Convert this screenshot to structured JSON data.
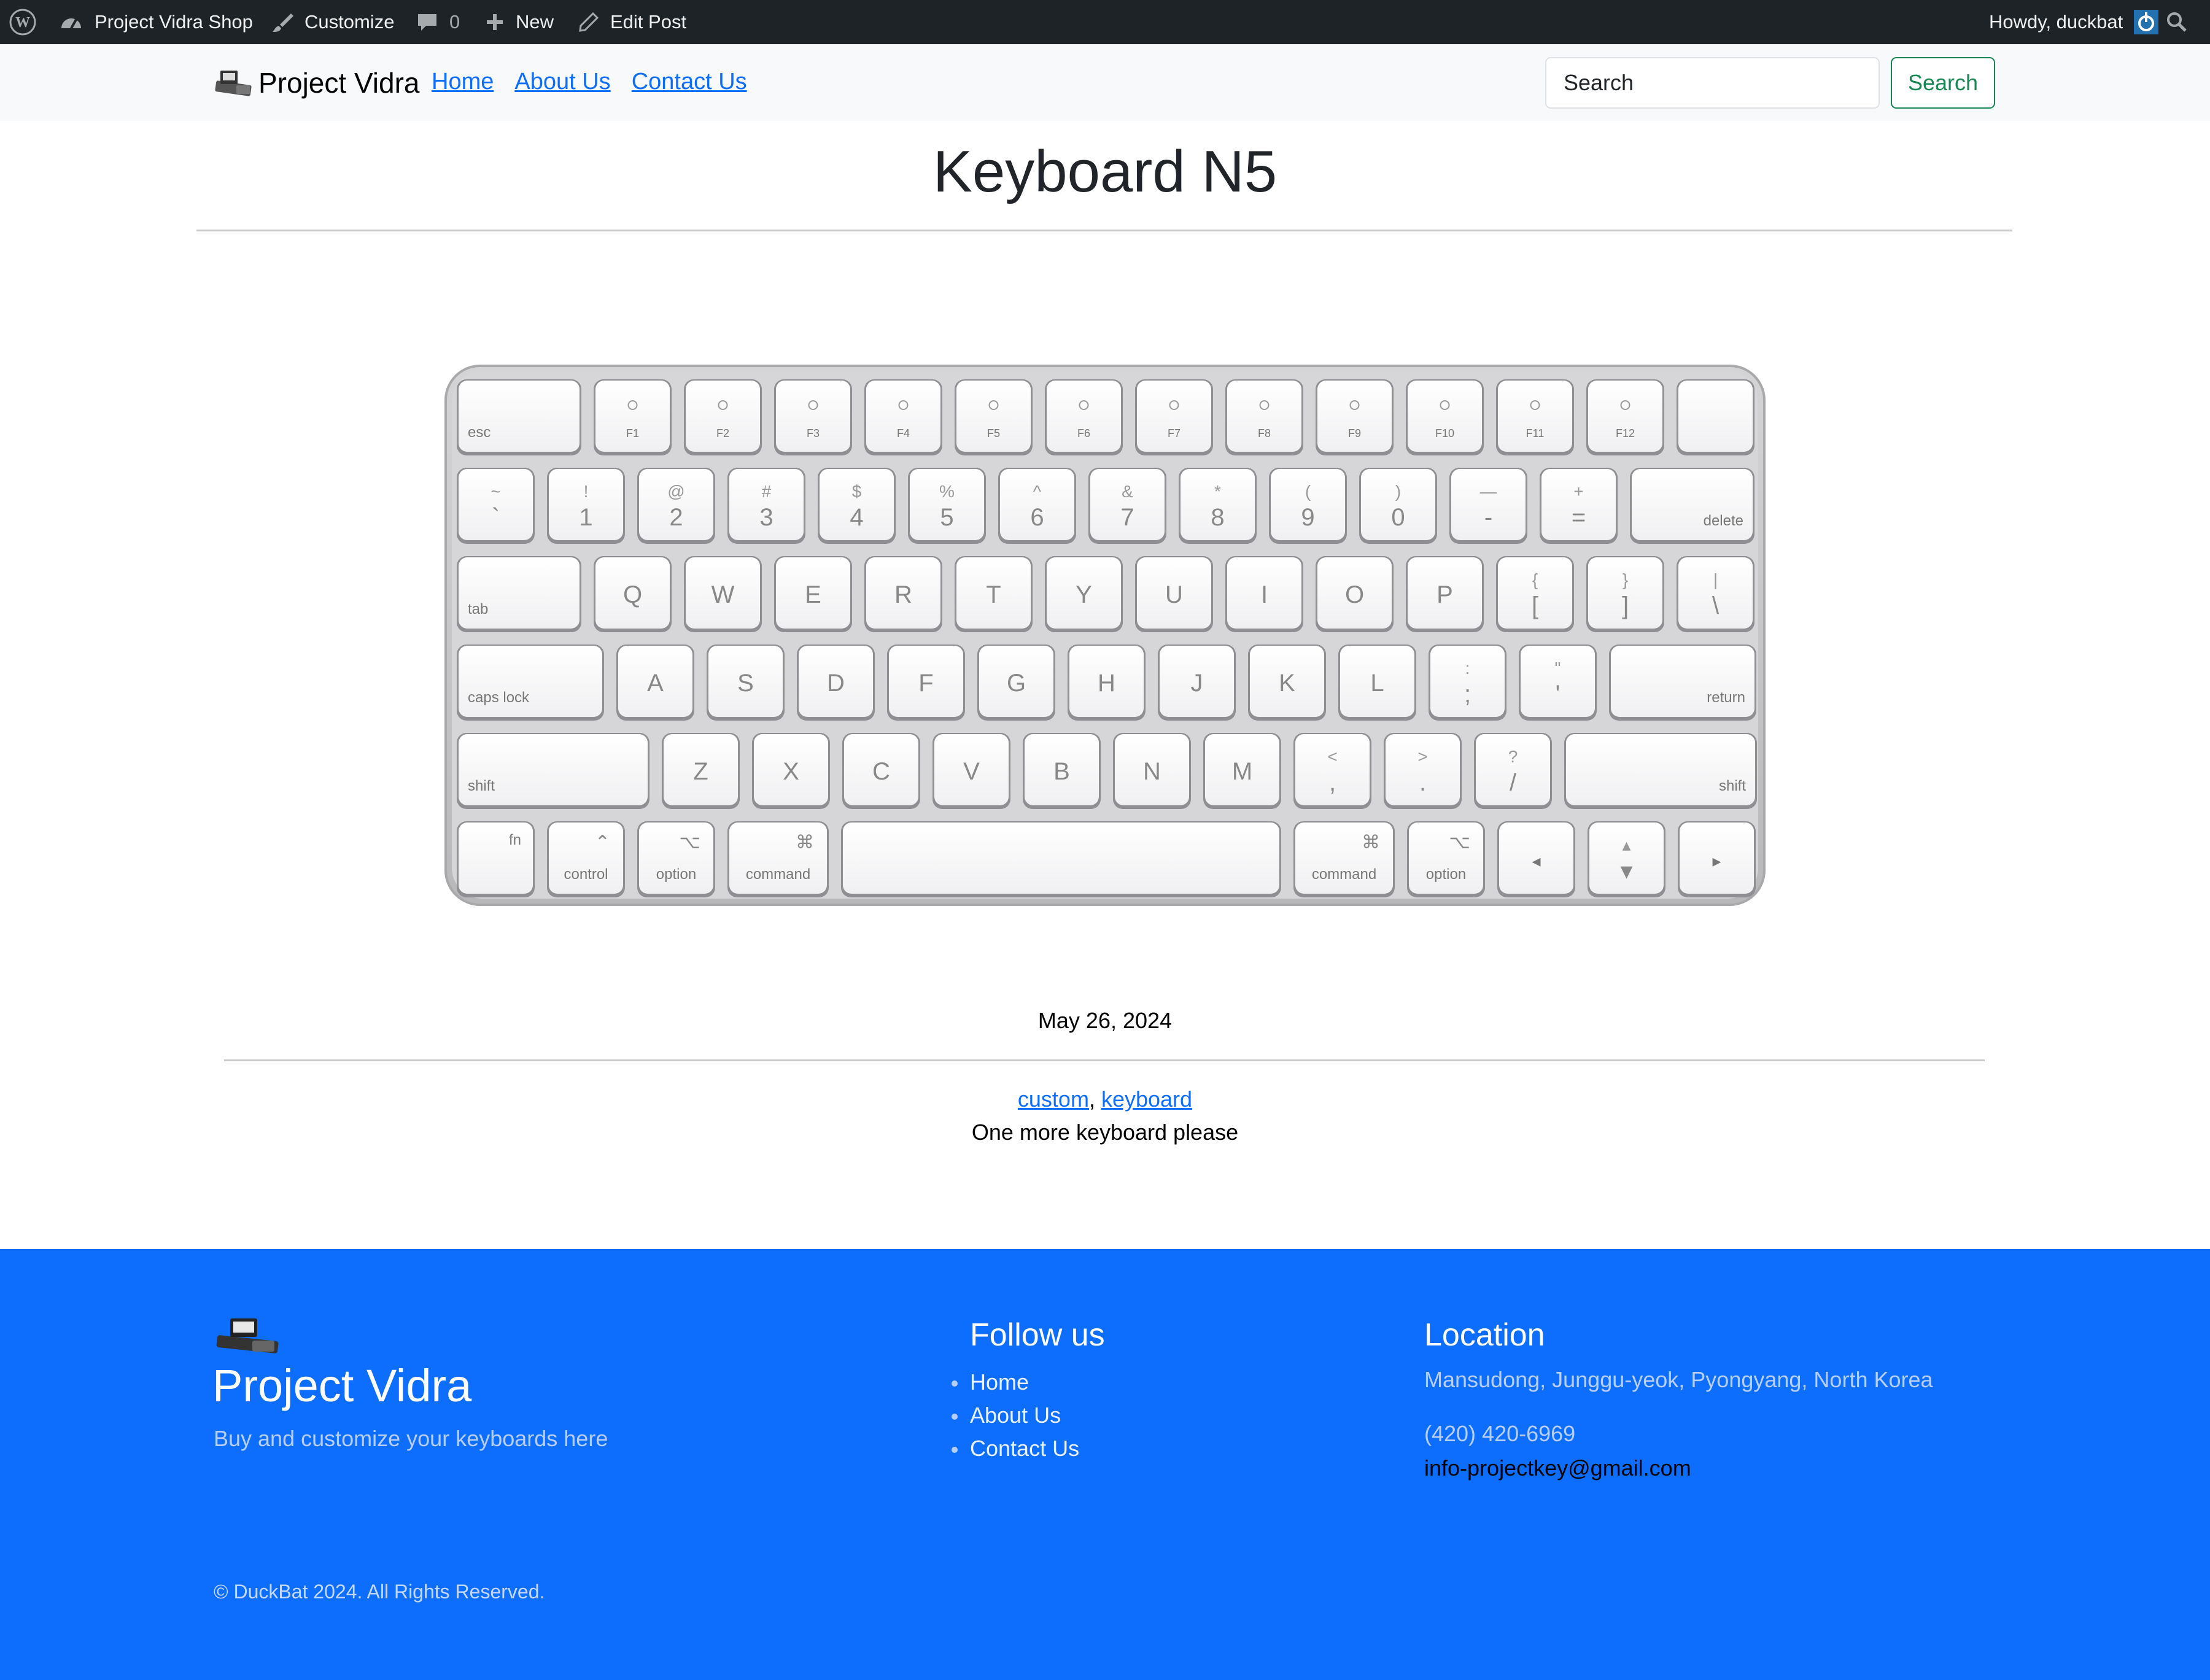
{
  "admin_bar": {
    "site_name": "Project Vidra Shop",
    "customize": "Customize",
    "comments_count": "0",
    "new_label": "New",
    "edit_post": "Edit Post",
    "howdy": "Howdy, duckbat"
  },
  "navbar": {
    "brand": "Project Vidra",
    "links": [
      "Home",
      "About Us",
      "Contact Us"
    ],
    "search_placeholder": "Search",
    "search_button": "Search"
  },
  "post": {
    "title": "Keyboard N5",
    "date": "May 26, 2024",
    "tags": [
      "custom",
      "keyboard"
    ],
    "tag_separator": ", ",
    "excerpt": "One more keyboard please"
  },
  "keyboard_image": {
    "rows": [
      [
        [
          "esc",
          ""
        ],
        [
          "",
          "F1"
        ],
        [
          "",
          "F2"
        ],
        [
          "",
          "F3"
        ],
        [
          "",
          "F4"
        ],
        [
          "",
          "F5"
        ],
        [
          "",
          "F6"
        ],
        [
          "",
          "F7"
        ],
        [
          "",
          "F8"
        ],
        [
          "",
          "F9"
        ],
        [
          "",
          "F10"
        ],
        [
          "",
          "F11"
        ],
        [
          "",
          "F12"
        ],
        [
          "",
          ""
        ]
      ],
      [
        [
          "~",
          "`"
        ],
        [
          "!",
          "1"
        ],
        [
          "@",
          "2"
        ],
        [
          "#",
          "3"
        ],
        [
          "$",
          "4"
        ],
        [
          "%",
          "5"
        ],
        [
          "^",
          "6"
        ],
        [
          "&",
          "7"
        ],
        [
          "*",
          "8"
        ],
        [
          "(",
          "9"
        ],
        [
          ")",
          "0"
        ],
        [
          "—",
          "-"
        ],
        [
          "+",
          "="
        ],
        [
          "delete",
          ""
        ]
      ],
      [
        [
          "tab",
          ""
        ],
        [
          "Q",
          ""
        ],
        [
          "W",
          ""
        ],
        [
          "E",
          ""
        ],
        [
          "R",
          ""
        ],
        [
          "T",
          ""
        ],
        [
          "Y",
          ""
        ],
        [
          "U",
          ""
        ],
        [
          "I",
          ""
        ],
        [
          "O",
          ""
        ],
        [
          "P",
          ""
        ],
        [
          "{",
          "["
        ],
        [
          "}",
          "]"
        ],
        [
          "|",
          "\\"
        ]
      ],
      [
        [
          "caps lock",
          ""
        ],
        [
          "A",
          ""
        ],
        [
          "S",
          ""
        ],
        [
          "D",
          ""
        ],
        [
          "F",
          ""
        ],
        [
          "G",
          ""
        ],
        [
          "H",
          ""
        ],
        [
          "J",
          ""
        ],
        [
          "K",
          ""
        ],
        [
          "L",
          ""
        ],
        [
          ":",
          ";"
        ],
        [
          "\"",
          "'"
        ],
        [
          "return",
          ""
        ]
      ],
      [
        [
          "shift",
          ""
        ],
        [
          "Z",
          ""
        ],
        [
          "X",
          ""
        ],
        [
          "C",
          ""
        ],
        [
          "V",
          ""
        ],
        [
          "B",
          ""
        ],
        [
          "N",
          ""
        ],
        [
          "M",
          ""
        ],
        [
          "<",
          ","
        ],
        [
          ">",
          "."
        ],
        [
          "?",
          "/"
        ],
        [
          "shift",
          ""
        ]
      ],
      [
        [
          "fn",
          ""
        ],
        [
          "⌃",
          "control"
        ],
        [
          "⌥",
          "option"
        ],
        [
          "⌘",
          "command"
        ],
        [
          "",
          ""
        ],
        [
          "⌘",
          "command"
        ],
        [
          "⌥",
          "option"
        ],
        [
          "◂",
          ""
        ],
        [
          "▴",
          "▾"
        ],
        [
          "▸",
          ""
        ]
      ]
    ]
  },
  "footer": {
    "brand": "Project Vidra",
    "tagline": "Buy and customize your keyboards here",
    "follow_heading": "Follow us",
    "follow_links": [
      "Home",
      "About Us",
      "Contact Us"
    ],
    "location_heading": "Location",
    "address": "Mansudong, Junggu-yeok, Pyongyang, North Korea",
    "phone": "(420) 420-6969",
    "email": "info-projectkey@gmail.com",
    "copyright": "© DuckBat 2024. All Rights Reserved."
  },
  "colors": {
    "admin_bar_bg": "#1d2327",
    "navbar_bg": "#f8f9fa",
    "link": "#0d6efd",
    "search_button": "#198754",
    "footer_bg": "#0d6efd"
  }
}
